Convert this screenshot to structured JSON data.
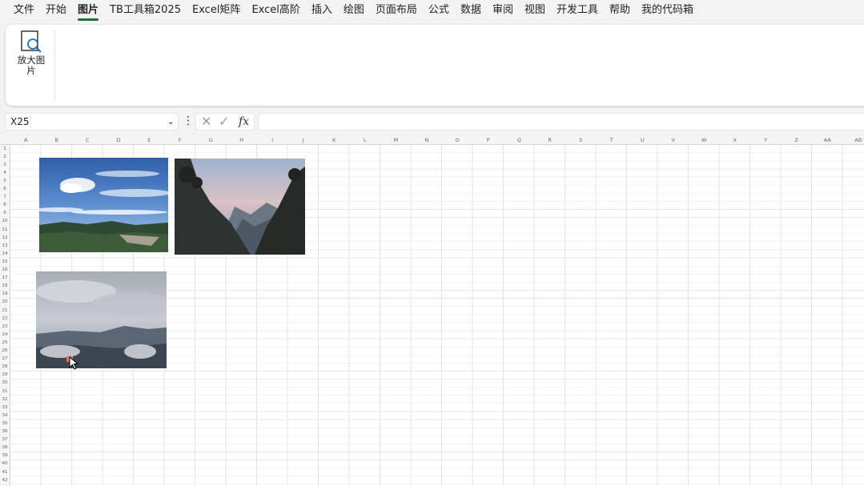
{
  "menu": {
    "items": [
      {
        "label": "文件"
      },
      {
        "label": "开始"
      },
      {
        "label": "图片",
        "active": true
      },
      {
        "label": "TB工具箱2025"
      },
      {
        "label": "Excel矩阵"
      },
      {
        "label": "Excel高阶"
      },
      {
        "label": "插入"
      },
      {
        "label": "绘图"
      },
      {
        "label": "页面布局"
      },
      {
        "label": "公式"
      },
      {
        "label": "数据"
      },
      {
        "label": "审阅"
      },
      {
        "label": "视图"
      },
      {
        "label": "开发工具"
      },
      {
        "label": "帮助"
      },
      {
        "label": "我的代码箱"
      }
    ]
  },
  "ribbon": {
    "zoom_button_label": "放大图片",
    "zoom_icon": "zoom-image-icon"
  },
  "formula_bar": {
    "name_box_value": "X25",
    "fx_label": "fx",
    "formula_value": ""
  },
  "sheet": {
    "columns": [
      "A",
      "B",
      "C",
      "D",
      "E",
      "F",
      "G",
      "H",
      "I",
      "J",
      "K",
      "L",
      "M",
      "N",
      "O",
      "P",
      "Q",
      "R",
      "S",
      "T",
      "U",
      "V",
      "W",
      "X",
      "Y",
      "Z",
      "AA",
      "AB"
    ],
    "rows": [
      "1",
      "2",
      "3",
      "4",
      "5",
      "6",
      "7",
      "8",
      "9",
      "10",
      "11",
      "12",
      "13",
      "14",
      "15",
      "16",
      "17",
      "18",
      "19",
      "20",
      "21",
      "22",
      "23",
      "24",
      "25",
      "26",
      "27",
      "28",
      "29",
      "30",
      "31",
      "32",
      "33",
      "34",
      "35",
      "36",
      "37",
      "38",
      "39",
      "40",
      "41",
      "42"
    ]
  },
  "colors": {
    "accent": "#1e6e3c",
    "active_cursor": "#e07a4f"
  }
}
